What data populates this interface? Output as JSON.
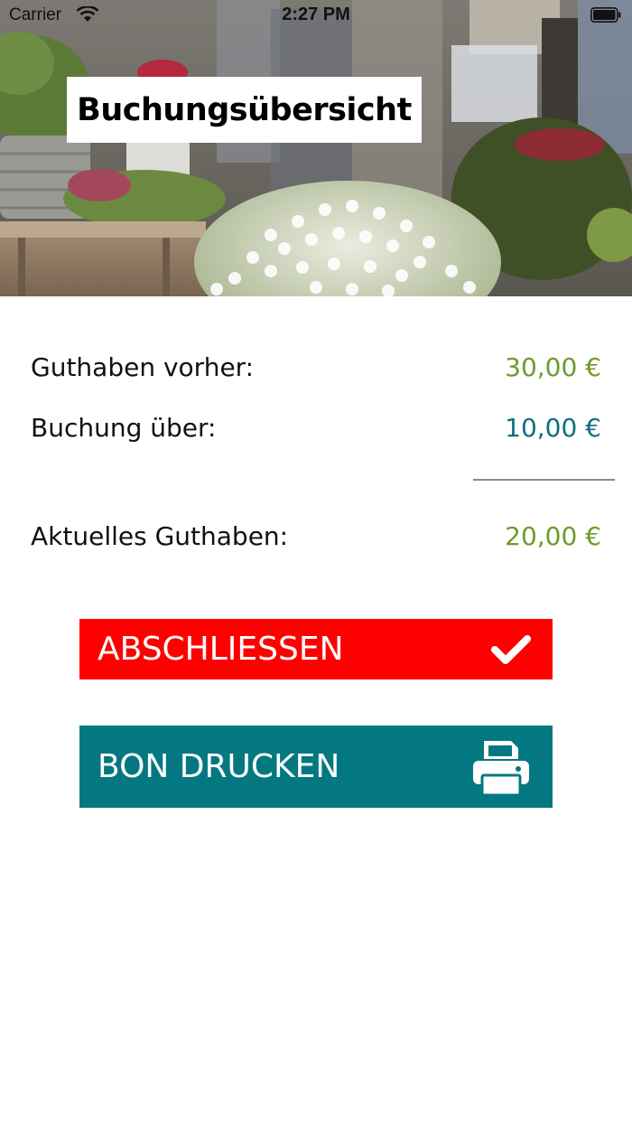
{
  "status_bar": {
    "carrier": "Carrier",
    "time": "2:27 PM",
    "wifi_icon": "wifi-icon",
    "battery_icon": "battery-icon"
  },
  "header": {
    "title": "Buchungsübersicht",
    "background": "photo of flower market with potted plants and white chrysanthemums"
  },
  "summary": {
    "previous_label": "Guthaben vorher:",
    "previous_value": "30,00 €",
    "booking_label": "Buchung über:",
    "booking_value": "10,00 €",
    "current_label": "Aktuelles Guthaben:",
    "current_value": "20,00 €"
  },
  "actions": {
    "finish_label": "ABSCHLIESSEN",
    "finish_icon": "checkmark-icon",
    "print_label": "BON DRUCKEN",
    "print_icon": "printer-icon"
  },
  "colors": {
    "finish_button": "#fe0000",
    "print_button": "#047881",
    "credit_value": "#6f9a2c",
    "booking_value": "#0e6f80"
  }
}
